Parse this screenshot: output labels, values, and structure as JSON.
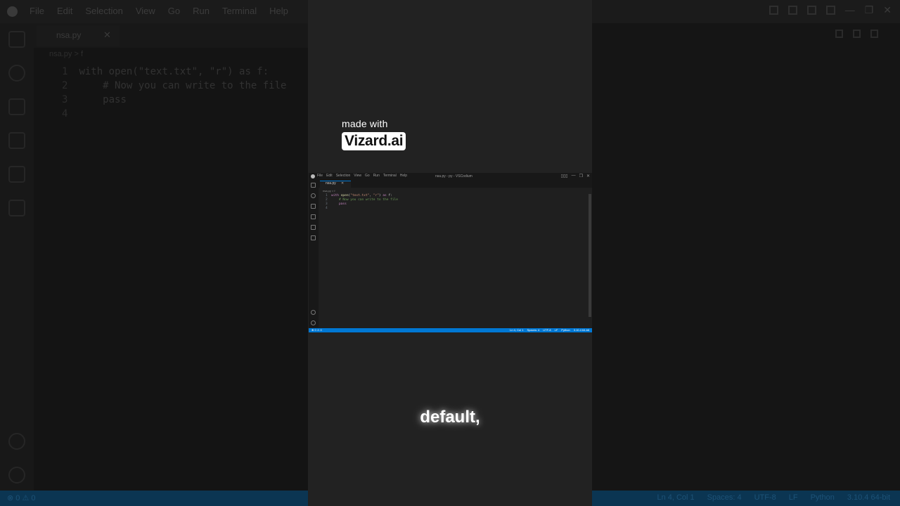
{
  "background_ui": {
    "menu": [
      "File",
      "Edit",
      "Selection",
      "View",
      "Go",
      "Run",
      "Terminal",
      "Help"
    ],
    "tab_label": "nsa.py",
    "breadcrumb": "nsa.py > f",
    "code_lines": [
      {
        "num": "1",
        "text": "with open(\"text.txt\", \"r\") as f:"
      },
      {
        "num": "2",
        "text": "    # Now you can write to the file"
      },
      {
        "num": "3",
        "text": "    pass"
      },
      {
        "num": "4",
        "text": ""
      }
    ],
    "status_left": "⊗ 0 ⚠ 0",
    "status_right": [
      "Ln 4, Col 1",
      "Spaces: 4",
      "UTF-8",
      "LF",
      "Python",
      "3.10.4 64-bit"
    ]
  },
  "watermark": {
    "made_with": "made with",
    "brand": "Vizard.ai"
  },
  "caption": "default,",
  "mini_ui": {
    "title": "nsa.py - py - VSCodium",
    "menu": [
      "File",
      "Edit",
      "Selection",
      "View",
      "Go",
      "Run",
      "Terminal",
      "Help"
    ],
    "tab_label": "nsa.py",
    "breadcrumb": "nsa.py > f",
    "status_left": "⊗ 0 ⚠ 0",
    "status_right": [
      "Ln 4, Col 1",
      "Spaces: 4",
      "UTF-8",
      "LF",
      "Python",
      "3.10.4 64-bit"
    ]
  },
  "colors": {
    "accent": "#0078d4",
    "statusbar_dim": "#0b3552"
  }
}
